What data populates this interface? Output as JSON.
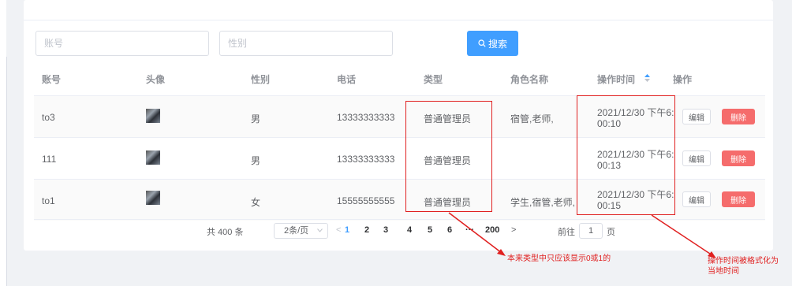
{
  "search": {
    "account_placeholder": "账号",
    "gender_placeholder": "性别",
    "button_label": "搜索"
  },
  "table": {
    "headers": [
      "账号",
      "头像",
      "性别",
      "电话",
      "类型",
      "角色名称",
      "操作时间",
      "操作"
    ],
    "rows": [
      {
        "account": "to3",
        "gender": "男",
        "phone": "13333333333",
        "type": "普通管理员",
        "role": "宿管,老师,",
        "time_line1": "2021/12/30 下午6:",
        "time_line2": "00:10",
        "edit": "编辑",
        "delete": "删除"
      },
      {
        "account": "111",
        "gender": "男",
        "phone": "13333333333",
        "type": "普通管理员",
        "role": "",
        "time_line1": "2021/12/30 下午6:",
        "time_line2": "00:13",
        "edit": "编辑",
        "delete": "删除"
      },
      {
        "account": "to1",
        "gender": "女",
        "phone": "15555555555",
        "type": "普通管理员",
        "role": "学生,宿管,老师,",
        "time_line1": "2021/12/30 下午6:",
        "time_line2": "00:15",
        "edit": "编辑",
        "delete": "删除"
      }
    ]
  },
  "pagination": {
    "total": "共 400 条",
    "page_size": "2条/页",
    "prev": "<",
    "pages": [
      "1",
      "2",
      "3",
      "4",
      "5",
      "6"
    ],
    "ellipsis": "···",
    "last": "200",
    "next": ">",
    "goto_label": "前往",
    "goto_value": "1",
    "page_unit": "页"
  },
  "annotations": {
    "type_note": "本来类型中只应该显示0或1的",
    "time_note_line1": "操作时间被格式化为",
    "time_note_line2": "当地时间"
  },
  "colors": {
    "primary": "#409eff",
    "danger": "#f56c6c",
    "annotation_red": "#e02020"
  }
}
